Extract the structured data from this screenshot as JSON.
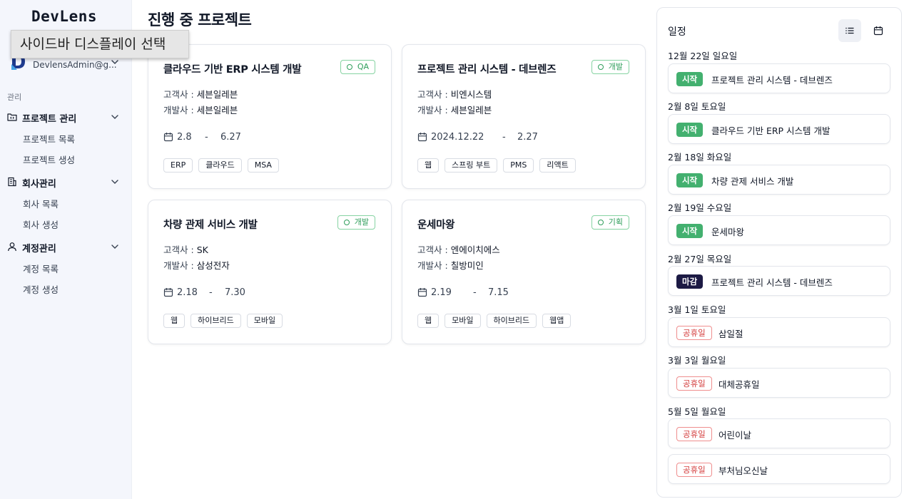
{
  "app": {
    "logo": "DevLens"
  },
  "tooltip": {
    "text": "사이드바 디스플레이 선택"
  },
  "user": {
    "email": "DevlensAdmin@g..."
  },
  "sidebar": {
    "section_label": "관리",
    "groups": [
      {
        "label": "프로젝트 관리",
        "icon": "folder-code-icon",
        "items": [
          "프로젝트 목록",
          "프로젝트 생성"
        ]
      },
      {
        "label": "회사관리",
        "icon": "building-icon",
        "items": [
          "회사 목록",
          "회사 생성"
        ]
      },
      {
        "label": "계정관리",
        "icon": "user-icon",
        "items": [
          "계정 목록",
          "계정 생성"
        ]
      }
    ]
  },
  "main": {
    "title": "진행 중 프로젝트",
    "client_label": "고객사 :",
    "developer_label": "개발사 :",
    "date_separator": "-",
    "projects": [
      {
        "title": "클라우드 기반 ERP 시스템 개발",
        "status": "QA",
        "client": "세븐일레븐",
        "developer": "세븐일레븐",
        "start": "2.8",
        "end": "6.27",
        "tags": [
          "ERP",
          "클라우드",
          "MSA"
        ]
      },
      {
        "title": "프로젝트 관리 시스템 - 데브렌즈",
        "status": "개발",
        "client": "비엔시스템",
        "developer": "세븐일레븐",
        "start": "2024.12.22",
        "end": "2.27",
        "tags": [
          "웹",
          "스프링 부트",
          "PMS",
          "리액트"
        ]
      },
      {
        "title": "차량 관제 서비스 개발",
        "status": "개발",
        "client": "SK",
        "developer": "삼성전자",
        "start": "2.18",
        "end": "7.30",
        "tags": [
          "웹",
          "하이브리드",
          "모바일"
        ]
      },
      {
        "title": "운세마왕",
        "status": "기획",
        "client": "엔에이치에스",
        "developer": "칠방미인",
        "start": "2.19",
        "end": "7.15",
        "tags": [
          "웹",
          "모바일",
          "하이브리드",
          "웹앱"
        ]
      }
    ]
  },
  "schedule": {
    "title": "일정",
    "view_buttons": [
      "list-icon",
      "calendar-icon"
    ],
    "days": [
      {
        "label": "12월 22일 일요일",
        "events": [
          {
            "type": "start",
            "badge": "시작",
            "title": "프로젝트 관리 시스템 - 데브렌즈"
          }
        ]
      },
      {
        "label": "2월 8일 토요일",
        "events": [
          {
            "type": "start",
            "badge": "시작",
            "title": "클라우드 기반 ERP 시스템 개발"
          }
        ]
      },
      {
        "label": "2월 18일 화요일",
        "events": [
          {
            "type": "start",
            "badge": "시작",
            "title": "차량 관제 서비스 개발"
          }
        ]
      },
      {
        "label": "2월 19일 수요일",
        "events": [
          {
            "type": "start",
            "badge": "시작",
            "title": "운세마왕"
          }
        ]
      },
      {
        "label": "2월 27일 목요일",
        "events": [
          {
            "type": "end",
            "badge": "마감",
            "title": "프로젝트 관리 시스템 - 데브렌즈"
          }
        ]
      },
      {
        "label": "3월 1일 토요일",
        "events": [
          {
            "type": "holiday",
            "badge": "공휴일",
            "title": "삼일절"
          }
        ]
      },
      {
        "label": "3월 3일 월요일",
        "events": [
          {
            "type": "holiday",
            "badge": "공휴일",
            "title": "대체공휴일"
          }
        ]
      },
      {
        "label": "5월 5일 월요일",
        "events": [
          {
            "type": "holiday",
            "badge": "공휴일",
            "title": "어린이날"
          },
          {
            "type": "holiday",
            "badge": "공휴일",
            "title": "부처님오신날"
          }
        ]
      }
    ]
  }
}
